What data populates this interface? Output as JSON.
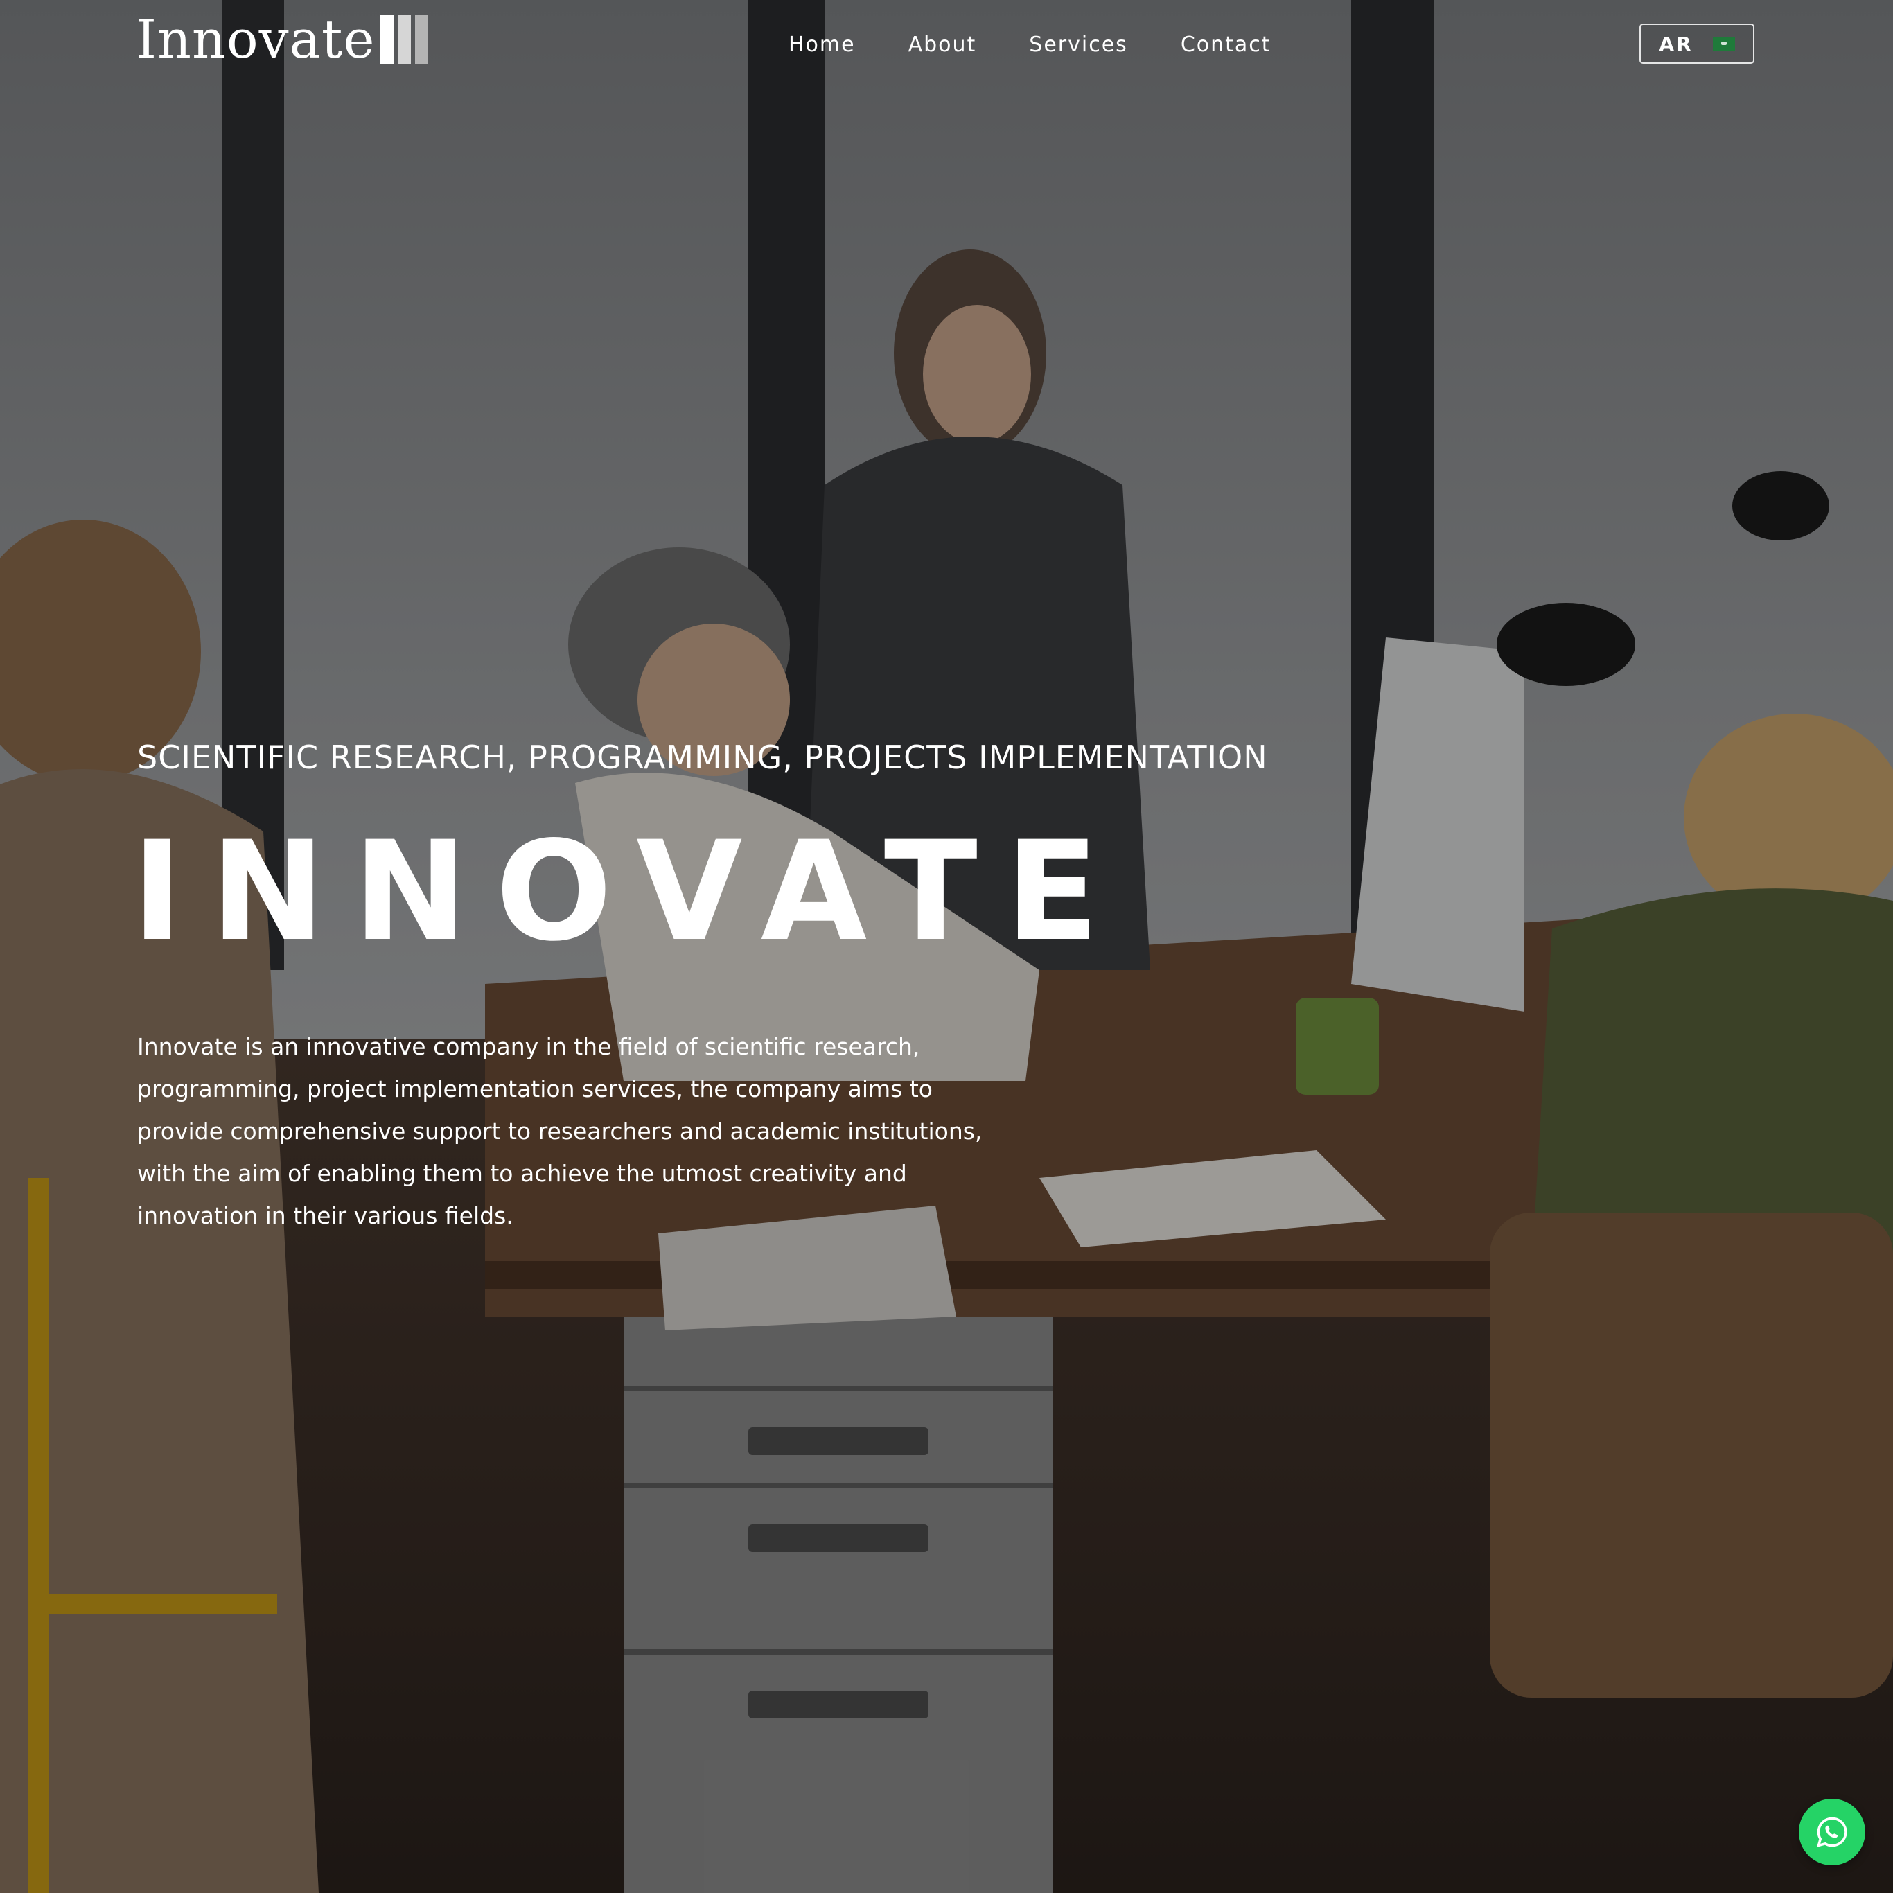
{
  "header": {
    "logo_text": "Innovate",
    "nav": [
      "Home",
      "About",
      "Services",
      "Contact"
    ],
    "language_button": {
      "label": "AR",
      "icon": "saudi-flag-icon"
    }
  },
  "hero": {
    "tagline": "SCIENTIFIC RESEARCH, PROGRAMMING, PROJECTS IMPLEMENTATION",
    "title": "INNOVATE",
    "description": "Innovate is an innovative company in the field of scientific research, programming, project implementation services, the company aims to provide comprehensive support to researchers and academic institutions, with the aim of enabling them to achieve the utmost creativity and innovation in their various fields."
  },
  "floating": {
    "whatsapp_icon": "whatsapp-icon"
  },
  "colors": {
    "text": "#ffffff",
    "whatsapp": "#25d366",
    "flag": "#1f7a3a"
  }
}
